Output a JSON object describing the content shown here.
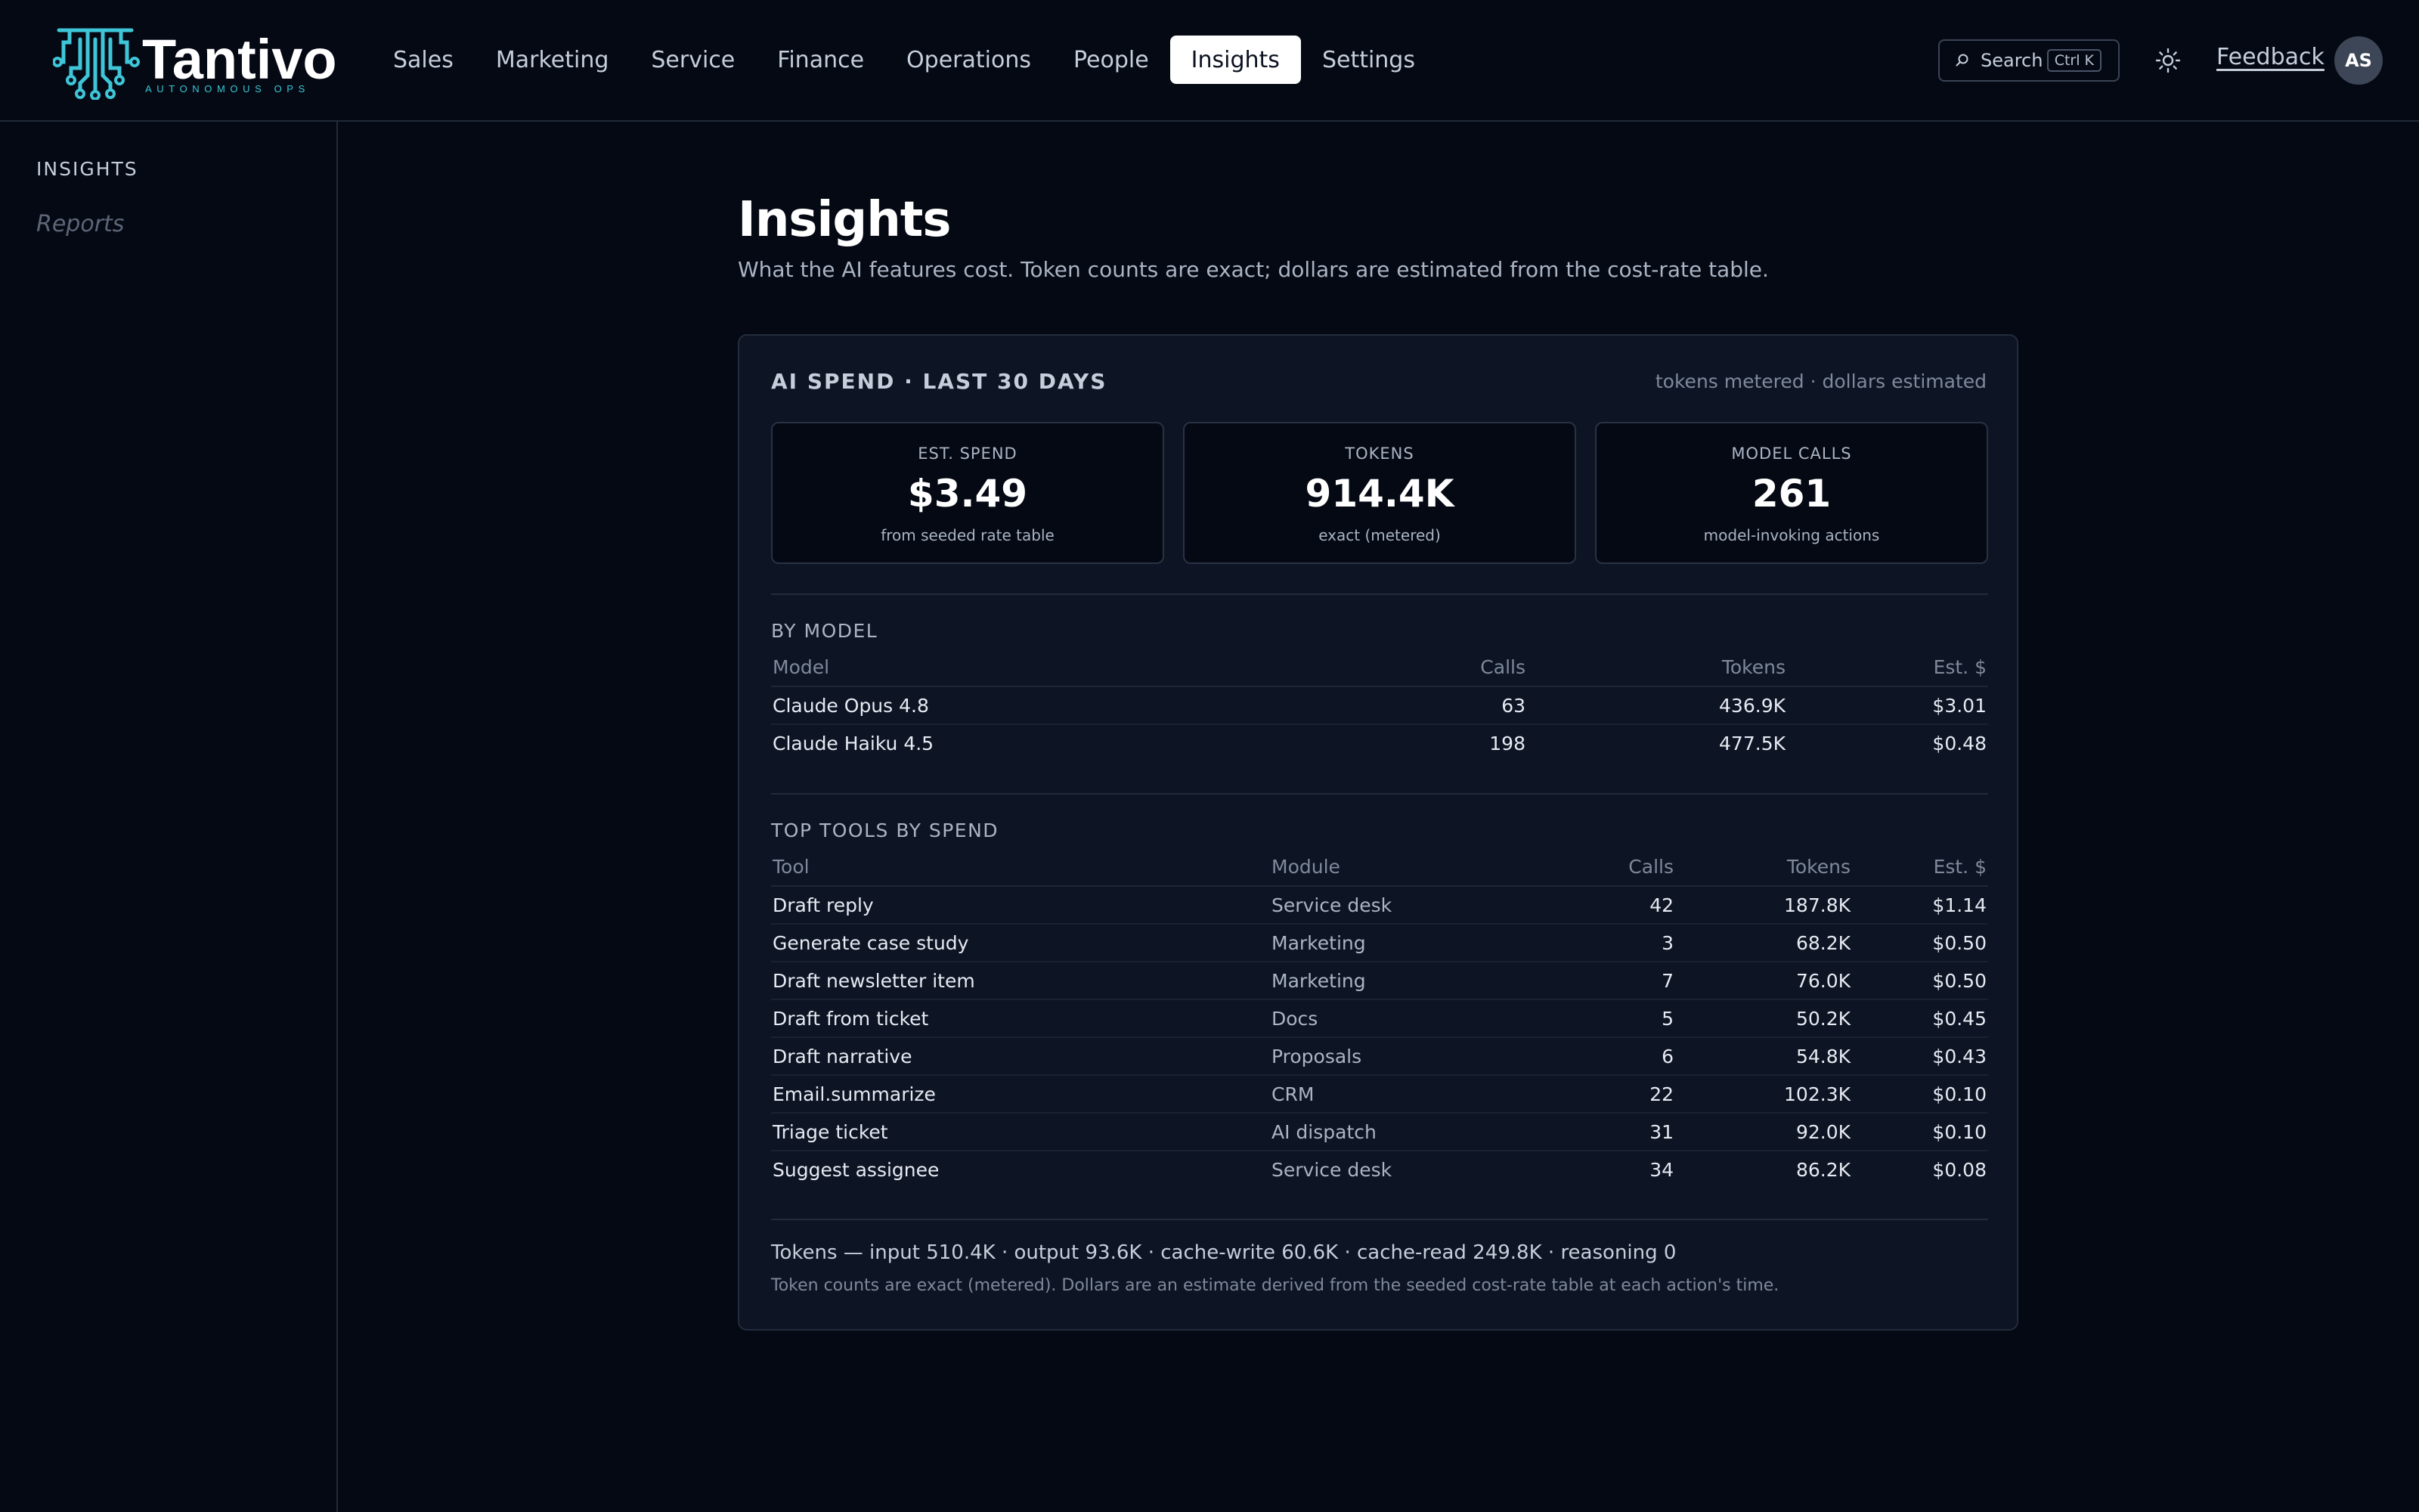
{
  "brand": {
    "name": "Tantivo",
    "tagline": "AUTONOMOUS OPS"
  },
  "nav": {
    "items": [
      "Sales",
      "Marketing",
      "Service",
      "Finance",
      "Operations",
      "People",
      "Insights",
      "Settings"
    ],
    "active": "Insights"
  },
  "search": {
    "label": "Search",
    "shortcut": "Ctrl K"
  },
  "header_actions": {
    "feedback": "Feedback",
    "avatar_initials": "AS",
    "theme_icon": "sun-icon"
  },
  "sidebar": {
    "heading": "INSIGHTS",
    "links": [
      "Reports"
    ]
  },
  "page": {
    "title": "Insights",
    "subtitle": "What the AI features cost. Token counts are exact; dollars are estimated from the cost-rate table."
  },
  "spend_card": {
    "heading": "AI SPEND · LAST 30 DAYS",
    "note": "tokens metered · dollars estimated",
    "kpis": [
      {
        "label": "EST. SPEND",
        "value": "$3.49",
        "sub": "from seeded rate table"
      },
      {
        "label": "TOKENS",
        "value": "914.4K",
        "sub": "exact (metered)"
      },
      {
        "label": "MODEL CALLS",
        "value": "261",
        "sub": "model-invoking actions"
      }
    ],
    "by_model": {
      "title": "BY MODEL",
      "headers": [
        "Model",
        "Calls",
        "Tokens",
        "Est. $"
      ],
      "rows": [
        [
          "Claude Opus 4.8",
          "63",
          "436.9K",
          "$3.01"
        ],
        [
          "Claude Haiku 4.5",
          "198",
          "477.5K",
          "$0.48"
        ]
      ]
    },
    "top_tools": {
      "title": "TOP TOOLS BY SPEND",
      "headers": [
        "Tool",
        "Module",
        "Calls",
        "Tokens",
        "Est. $"
      ],
      "rows": [
        [
          "Draft reply",
          "Service desk",
          "42",
          "187.8K",
          "$1.14"
        ],
        [
          "Generate case study",
          "Marketing",
          "3",
          "68.2K",
          "$0.50"
        ],
        [
          "Draft newsletter item",
          "Marketing",
          "7",
          "76.0K",
          "$0.50"
        ],
        [
          "Draft from ticket",
          "Docs",
          "5",
          "50.2K",
          "$0.45"
        ],
        [
          "Draft narrative",
          "Proposals",
          "6",
          "54.8K",
          "$0.43"
        ],
        [
          "Email.summarize",
          "CRM",
          "22",
          "102.3K",
          "$0.10"
        ],
        [
          "Triage ticket",
          "AI dispatch",
          "31",
          "92.0K",
          "$0.10"
        ],
        [
          "Suggest assignee",
          "Service desk",
          "34",
          "86.2K",
          "$0.08"
        ]
      ]
    },
    "token_breakdown": "Tokens — input 510.4K · output 93.6K · cache-write 60.6K · cache-read 249.8K · reasoning 0",
    "footnote": "Token counts are exact (metered). Dollars are an estimate derived from the seeded cost-rate table at each action's time."
  }
}
